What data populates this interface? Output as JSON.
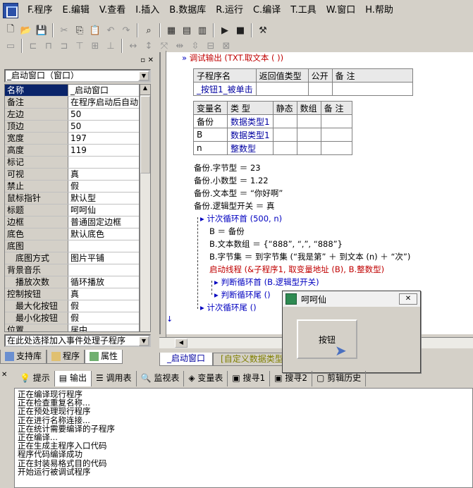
{
  "menu": {
    "items": [
      "F.程序",
      "E.编辑",
      "V.查看",
      "I.插入",
      "B.数据库",
      "R.运行",
      "C.编译",
      "T.工具",
      "W.窗口",
      "H.帮助"
    ]
  },
  "left": {
    "combo_value": "_启动窗口（窗口）",
    "props": [
      {
        "k": "名称",
        "v": "_启动窗口",
        "sel": true
      },
      {
        "k": "备注",
        "v": "在程序启动后自动"
      },
      {
        "k": "左边",
        "v": "50"
      },
      {
        "k": "顶边",
        "v": "50"
      },
      {
        "k": "宽度",
        "v": "197"
      },
      {
        "k": "高度",
        "v": "119"
      },
      {
        "k": "标记",
        "v": ""
      },
      {
        "k": "可视",
        "v": "真"
      },
      {
        "k": "禁止",
        "v": "假"
      },
      {
        "k": "鼠标指针",
        "v": "默认型"
      },
      {
        "k": "标题",
        "v": "呵呵仙"
      },
      {
        "k": "边框",
        "v": "普通固定边框"
      },
      {
        "k": "底色",
        "v": "默认底色"
      },
      {
        "k": "底图",
        "v": ""
      },
      {
        "k": "　底图方式",
        "v": "图片平铺"
      },
      {
        "k": "背景音乐",
        "v": ""
      },
      {
        "k": "　播放次数",
        "v": "循环播放"
      },
      {
        "k": "控制按钮",
        "v": "真"
      },
      {
        "k": "　最大化按钮",
        "v": "假"
      },
      {
        "k": "　最小化按钮",
        "v": "假"
      },
      {
        "k": "位置",
        "v": "居中"
      }
    ],
    "tip": "在此处选择加入事件处理子程序",
    "tabs": [
      "支持库",
      "程序",
      "属性"
    ]
  },
  "editor": {
    "debug_line": "调试输出 (TXT.取文本 ( ))",
    "sub_header": [
      "子程序名",
      "返回值类型",
      "公开",
      "备 注"
    ],
    "sub_row": [
      "_按钮1_被单击",
      "",
      "",
      ""
    ],
    "var_header": [
      "变量名",
      "类 型",
      "静态",
      "数组",
      "备 注"
    ],
    "var_rows": [
      [
        "备份",
        "数据类型1",
        "",
        "",
        ""
      ],
      [
        "B",
        "数据类型1",
        "",
        "",
        ""
      ],
      [
        "n",
        "整数型",
        "",
        "",
        ""
      ]
    ],
    "lines": [
      "备份.字节型 ＝ 23",
      "备份.小数型 ＝ 1.22",
      "备份.文本型 ＝ “你好啊”",
      "备份.逻辑型开关 ＝ 真",
      "计次循环首 (500, n)",
      "B ＝ 备份",
      "B.文本数组 ＝ {“888”, “,”, “888”}",
      "B.字节集 ＝ 到字节集 (“我是第” ＋ 到文本 (n) ＋ “次”)",
      "启动线程 (&子程序1, 取变量地址 (B), B.整数型)",
      "判断循环首 (B.逻辑型开关)",
      "判断循环尾 ()",
      "计次循环尾 ()"
    ],
    "tabs": [
      "_启动窗口",
      "[自定义数据类型]"
    ]
  },
  "popup": {
    "title": "呵呵仙",
    "button": "按钮"
  },
  "bottom": {
    "tabs": [
      "提示",
      "输出",
      "调用表",
      "监视表",
      "变量表",
      "搜寻1",
      "搜寻2",
      "剪辑历史"
    ],
    "output": [
      "正在编译现行程序",
      "正在检查重复名称...",
      "正在预处理现行程序",
      "正在进行名称连接...",
      "正在统计需要编译的子程序",
      "正在编译...",
      "正在生成主程序入口代码",
      "程序代码编译成功",
      "正在封装易格式目的代码",
      "开始运行被调试程序"
    ]
  }
}
